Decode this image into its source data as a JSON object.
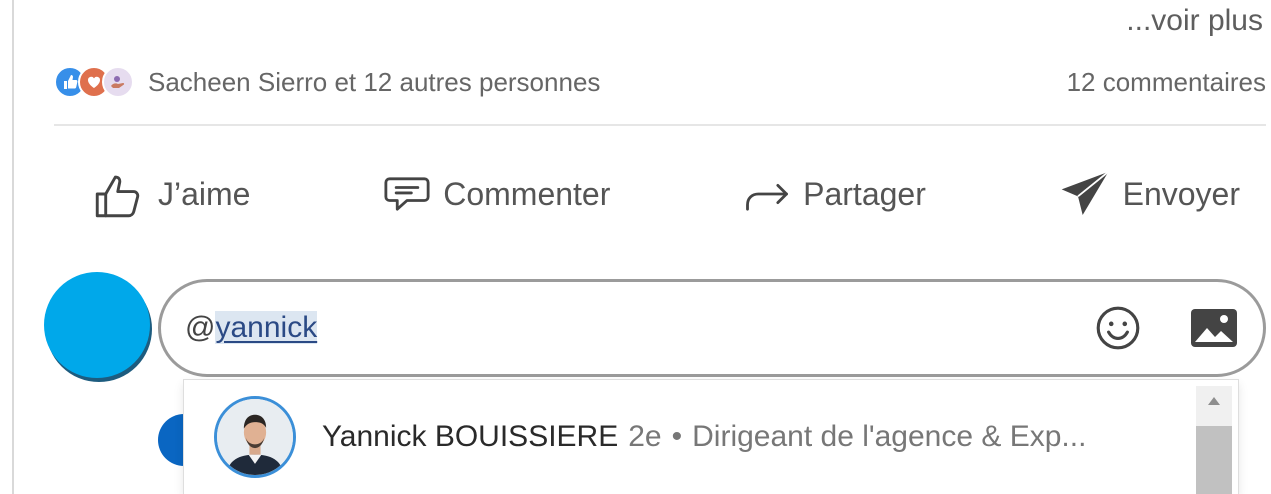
{
  "post": {
    "see_more": "...voir plus"
  },
  "social": {
    "reactions": [
      "like",
      "love",
      "support"
    ],
    "reactors_text": "Sacheen Sierro et 12 autres personnes",
    "comments_count": "12 commentaires"
  },
  "actions": {
    "like_label": "J’aime",
    "comment_label": "Commenter",
    "share_label": "Partager",
    "send_label": "Envoyer"
  },
  "comment_box": {
    "prefix": "@",
    "mention_text": "yannick",
    "emoji_icon": "emoji-icon",
    "image_icon": "image-icon"
  },
  "mention_dropdown": {
    "items": [
      {
        "name": "Yannick BOUISSIERE",
        "degree": "2e",
        "separator": "•",
        "title": "Dirigeant de l'agence & Exp..."
      }
    ]
  },
  "colors": {
    "accent": "#0a66c2",
    "avatar_bg": "#00a8ea",
    "like_reaction": "#378fe9",
    "love_reaction": "#df704d"
  }
}
